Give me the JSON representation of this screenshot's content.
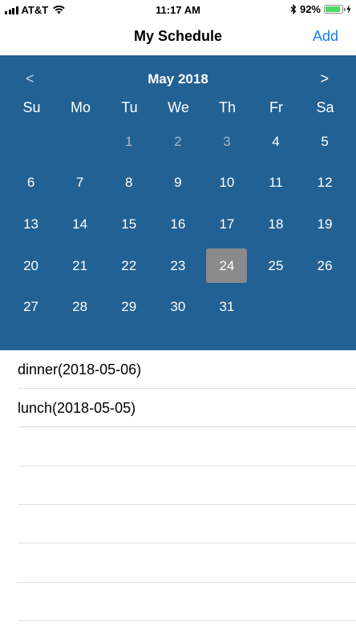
{
  "status_bar": {
    "carrier": "AT&T",
    "time": "11:17 AM",
    "battery_percent": "92%",
    "battery_level": 0.92,
    "battery_color": "#4cd964"
  },
  "nav": {
    "title": "My Schedule",
    "add_label": "Add",
    "accent_color": "#1a7cf5"
  },
  "calendar": {
    "background_color": "#226193",
    "month_label": "May 2018",
    "prev_label": "<",
    "next_label": ">",
    "weekdays": [
      "Su",
      "Mo",
      "Tu",
      "We",
      "Th",
      "Fr",
      "Sa"
    ],
    "days": [
      {
        "label": "",
        "muted": false,
        "selected": false
      },
      {
        "label": "",
        "muted": false,
        "selected": false
      },
      {
        "label": "1",
        "muted": true,
        "selected": false
      },
      {
        "label": "2",
        "muted": true,
        "selected": false
      },
      {
        "label": "3",
        "muted": true,
        "selected": false
      },
      {
        "label": "4",
        "muted": false,
        "selected": false
      },
      {
        "label": "5",
        "muted": false,
        "selected": false
      },
      {
        "label": "6",
        "muted": false,
        "selected": false
      },
      {
        "label": "7",
        "muted": false,
        "selected": false
      },
      {
        "label": "8",
        "muted": false,
        "selected": false
      },
      {
        "label": "9",
        "muted": false,
        "selected": false
      },
      {
        "label": "10",
        "muted": false,
        "selected": false
      },
      {
        "label": "11",
        "muted": false,
        "selected": false
      },
      {
        "label": "12",
        "muted": false,
        "selected": false
      },
      {
        "label": "13",
        "muted": false,
        "selected": false
      },
      {
        "label": "14",
        "muted": false,
        "selected": false
      },
      {
        "label": "15",
        "muted": false,
        "selected": false
      },
      {
        "label": "16",
        "muted": false,
        "selected": false
      },
      {
        "label": "17",
        "muted": false,
        "selected": false
      },
      {
        "label": "18",
        "muted": false,
        "selected": false
      },
      {
        "label": "19",
        "muted": false,
        "selected": false
      },
      {
        "label": "20",
        "muted": false,
        "selected": false
      },
      {
        "label": "21",
        "muted": false,
        "selected": false
      },
      {
        "label": "22",
        "muted": false,
        "selected": false
      },
      {
        "label": "23",
        "muted": false,
        "selected": false
      },
      {
        "label": "24",
        "muted": false,
        "selected": true
      },
      {
        "label": "25",
        "muted": false,
        "selected": false
      },
      {
        "label": "26",
        "muted": false,
        "selected": false
      },
      {
        "label": "27",
        "muted": false,
        "selected": false
      },
      {
        "label": "28",
        "muted": false,
        "selected": false
      },
      {
        "label": "29",
        "muted": false,
        "selected": false
      },
      {
        "label": "30",
        "muted": false,
        "selected": false
      },
      {
        "label": "31",
        "muted": false,
        "selected": false
      }
    ]
  },
  "events": [
    {
      "label": "dinner(2018-05-06)"
    },
    {
      "label": "lunch(2018-05-05)"
    },
    {
      "label": ""
    },
    {
      "label": ""
    },
    {
      "label": ""
    },
    {
      "label": ""
    },
    {
      "label": ""
    }
  ]
}
